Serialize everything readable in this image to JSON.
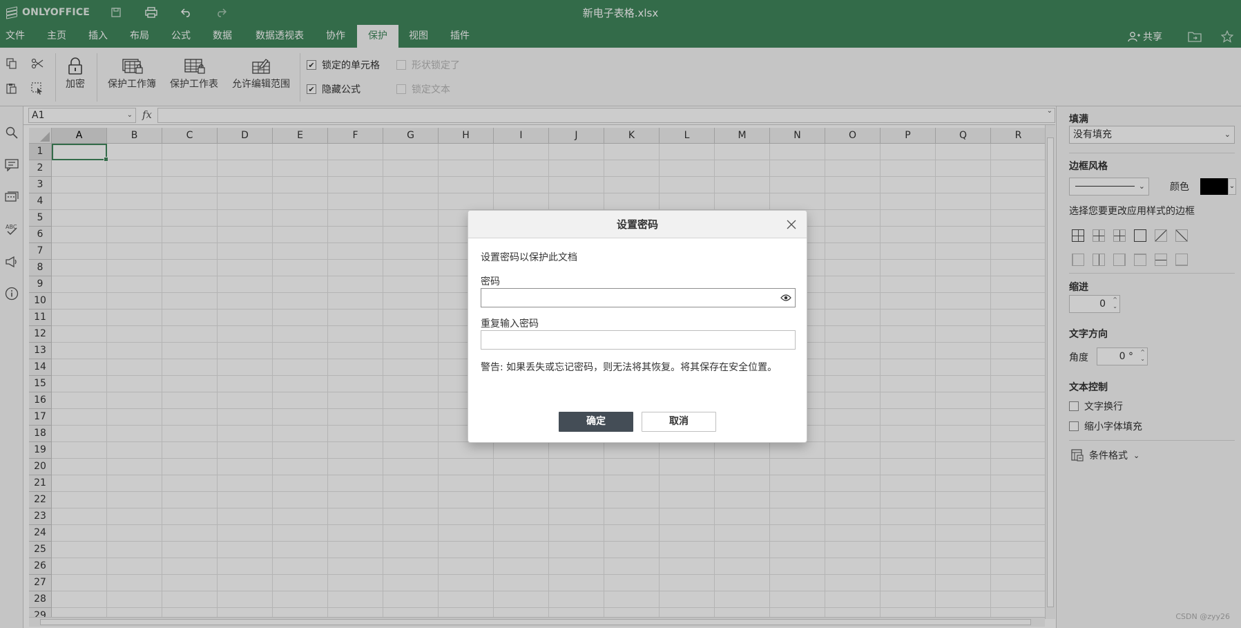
{
  "app": {
    "logo_text": "ONLYOFFICE",
    "doc_title": "新电子表格.xlsx",
    "accent": "#40865c"
  },
  "tabs": [
    {
      "label": "文件"
    },
    {
      "label": "主页"
    },
    {
      "label": "插入"
    },
    {
      "label": "布局"
    },
    {
      "label": "公式"
    },
    {
      "label": "数据"
    },
    {
      "label": "数据透视表"
    },
    {
      "label": "协作"
    },
    {
      "label": "保护",
      "active": true
    },
    {
      "label": "视图"
    },
    {
      "label": "插件"
    }
  ],
  "header_right": {
    "share_label": "共享"
  },
  "toolbar": {
    "encrypt_label": "加密",
    "protect_workbook_label": "保护工作簿",
    "protect_sheet_label": "保护工作表",
    "allow_ranges_label": "允许编辑范围",
    "checks": [
      {
        "label": "锁定的单元格",
        "checked": true,
        "enabled": true
      },
      {
        "label": "隐藏公式",
        "checked": true,
        "enabled": true
      },
      {
        "label": "形状锁定了",
        "checked": false,
        "enabled": false
      },
      {
        "label": "锁定文本",
        "checked": false,
        "enabled": false
      }
    ]
  },
  "formula_bar": {
    "cell_ref": "A1",
    "fx_label": "fx",
    "formula": ""
  },
  "grid": {
    "columns": [
      "A",
      "B",
      "C",
      "D",
      "E",
      "F",
      "G",
      "H",
      "I",
      "J",
      "K",
      "L",
      "M",
      "N",
      "O",
      "P",
      "Q",
      "R"
    ],
    "rows": [
      "1",
      "2",
      "3",
      "4",
      "5",
      "6",
      "7",
      "8",
      "9",
      "10",
      "11",
      "12",
      "13",
      "14",
      "15",
      "16",
      "17",
      "18",
      "19",
      "20",
      "21",
      "22",
      "23",
      "24",
      "25",
      "26",
      "27",
      "28",
      "29"
    ],
    "selected_cell": "A1"
  },
  "right_panel": {
    "fill_title": "填满",
    "fill_value": "没有填充",
    "border_style_title": "边框风格",
    "color_label": "颜色",
    "border_color": "#000000",
    "border_hint": "选择您要更改应用样式的边框",
    "indent_title": "缩进",
    "indent_value": "0",
    "text_dir_title": "文字方向",
    "angle_label": "角度",
    "angle_value": "0 °",
    "text_control_title": "文本控制",
    "wrap_label": "文字换行",
    "shrink_label": "缩小字体填充",
    "cond_format_label": "条件格式"
  },
  "dialog": {
    "title": "设置密码",
    "description": "设置密码以保护此文档",
    "password_label": "密码",
    "password_value": "",
    "repeat_label": "重复输入密码",
    "repeat_value": "",
    "warning": "警告: 如果丢失或忘记密码，则无法将其恢复。将其保存在安全位置。",
    "ok_label": "确定",
    "cancel_label": "取消"
  },
  "watermark": "CSDN @zyy26"
}
